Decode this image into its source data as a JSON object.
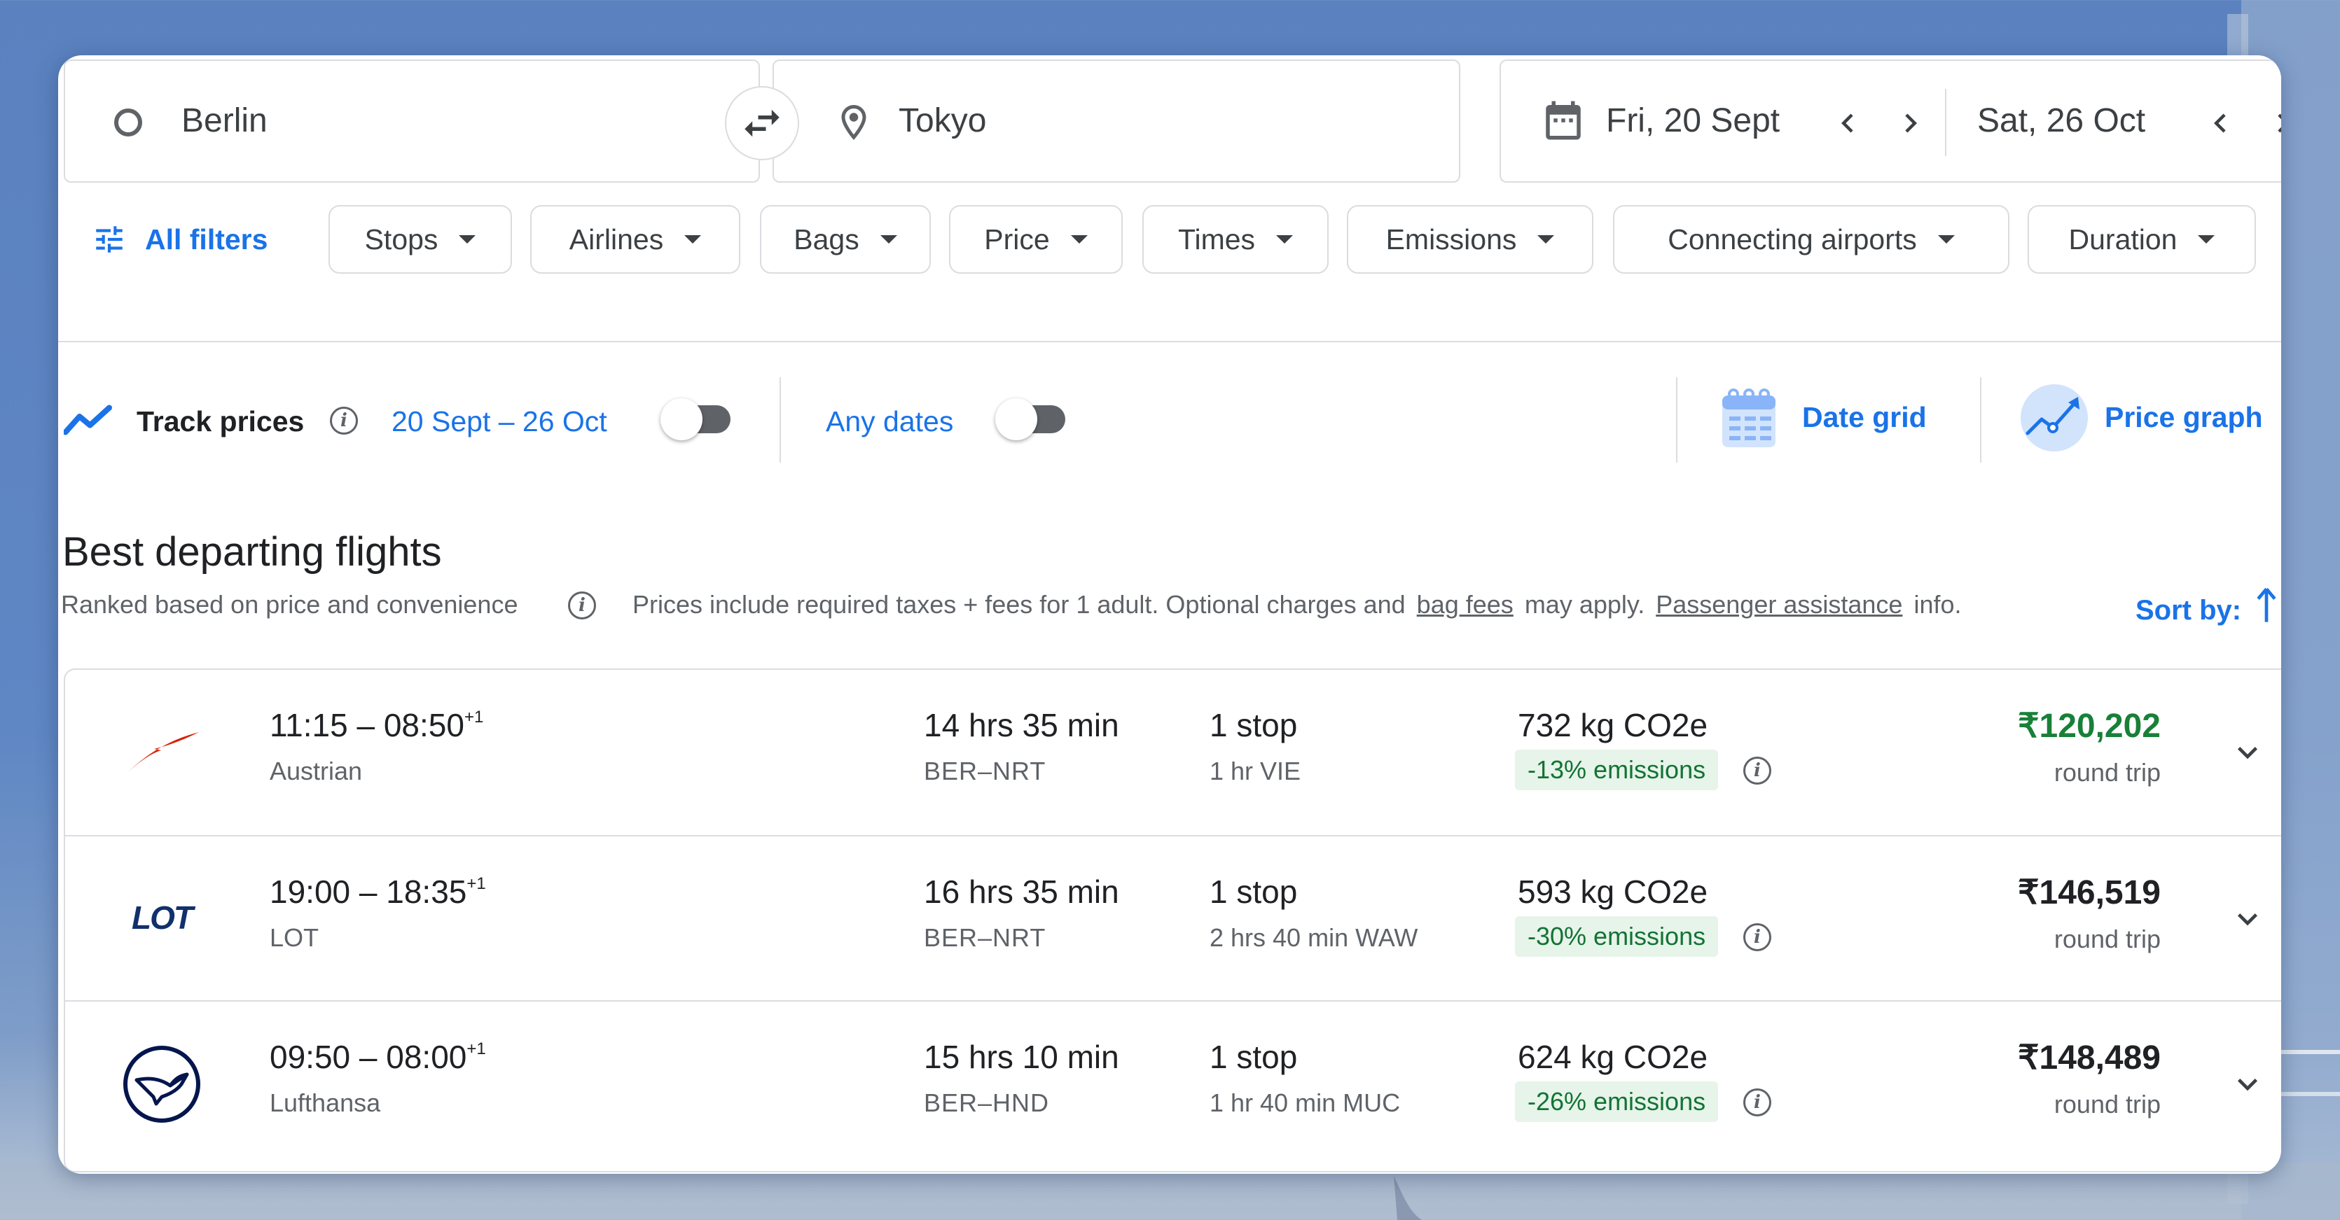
{
  "search": {
    "origin": "Berlin",
    "destination": "Tokyo",
    "depart_date": "Fri, 20 Sept",
    "return_date": "Sat, 26 Oct"
  },
  "filters": {
    "all_filters": "All filters",
    "chips": [
      "Stops",
      "Airlines",
      "Bags",
      "Price",
      "Times",
      "Emissions",
      "Connecting airports",
      "Duration"
    ]
  },
  "track": {
    "label": "Track prices",
    "range": "20 Sept – 26 Oct",
    "any_dates": "Any dates",
    "track_on": false,
    "any_dates_on": false,
    "date_grid": "Date grid",
    "price_graph": "Price graph"
  },
  "section": {
    "title": "Best departing flights",
    "ranked": "Ranked based on price and convenience",
    "prices_note": "Prices include required taxes + fees for 1 adult. Optional charges and",
    "bag_fees": "bag fees",
    "may_apply": "may apply.",
    "passenger_assistance": "Passenger assistance",
    "info": "info.",
    "sort_by": "Sort by:"
  },
  "flights": [
    {
      "times": "11:15 – 08:50",
      "day_offset": "+1",
      "airline": "Austrian",
      "logo": "austrian-logo",
      "duration": "14 hrs 35 min",
      "route": "BER–NRT",
      "stops": "1 stop",
      "layover": "1 hr VIE",
      "co2": "732 kg CO2e",
      "emissions": "-13% emissions",
      "price": "₹120,202",
      "price_type": "round trip"
    },
    {
      "times": "19:00 – 18:35",
      "day_offset": "+1",
      "airline": "LOT",
      "logo": "lot-logo",
      "logo_text": "LOT",
      "duration": "16 hrs 35 min",
      "route": "BER–NRT",
      "stops": "1 stop",
      "layover": "2 hrs 40 min WAW",
      "co2": "593 kg CO2e",
      "emissions": "-30% emissions",
      "price": "₹146,519",
      "price_type": "round trip"
    },
    {
      "times": "09:50 – 08:00",
      "day_offset": "+1",
      "airline": "Lufthansa",
      "logo": "lufthansa-logo",
      "duration": "15 hrs 10 min",
      "route": "BER–HND",
      "stops": "1 stop",
      "layover": "1 hr 40 min MUC",
      "co2": "624 kg CO2e",
      "emissions": "-26% emissions",
      "price": "₹148,489",
      "price_type": "round trip"
    }
  ],
  "colors": {
    "accent": "#1a73e8",
    "best_price": "#188038",
    "emissions_bg": "#e6f4ea",
    "emissions_text": "#137333"
  }
}
